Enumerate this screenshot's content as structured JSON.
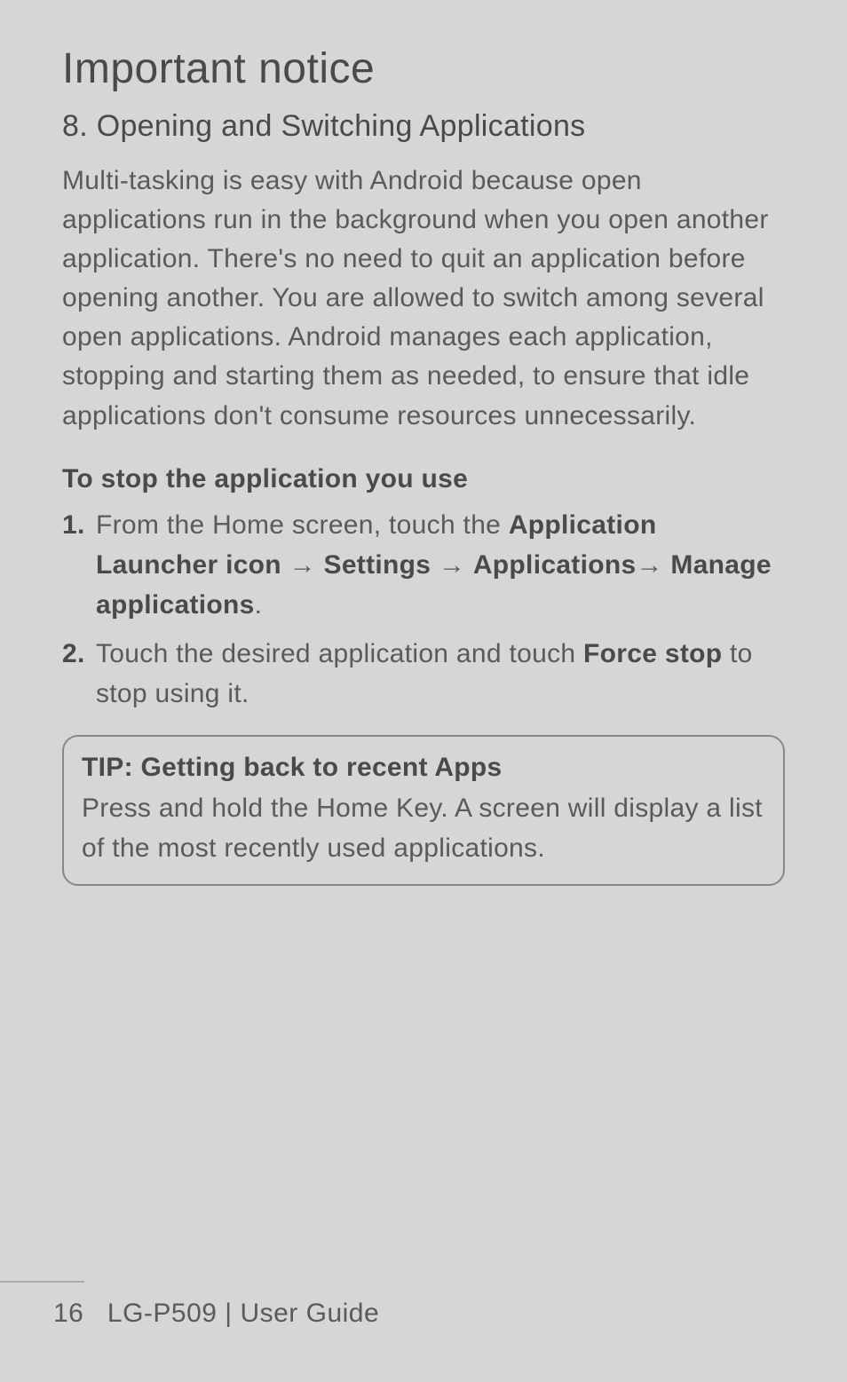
{
  "title": "Important notice",
  "section": {
    "heading": "8. Opening and Switching Applications",
    "body": "Multi-tasking is easy with Android because open applications run in the background when you open another application. There's no need to quit an application before opening another. You are allowed to switch among several open applications. Android manages each application, stopping and starting them as needed, to ensure that idle applications don't consume resources unnecessarily."
  },
  "subheading": "To stop the application you use",
  "steps": [
    {
      "num": "1.",
      "prefix": "From the Home screen, touch the ",
      "bold1": "Application Launcher icon",
      "arrow1": " → ",
      "bold2": "Settings",
      "arrow2": " → ",
      "bold3": "Applications",
      "arrow3": "→ ",
      "bold4": "Manage applications",
      "suffix": "."
    },
    {
      "num": "2.",
      "prefix": "Touch the desired application and touch ",
      "bold1": "Force stop",
      "suffix": " to stop using it."
    }
  ],
  "tip": {
    "title": "TIP: Getting back to recent Apps",
    "body": "Press and hold the Home Key. A screen will display a list of the most recently used applications."
  },
  "footer": {
    "page": "16",
    "model": "LG-P509",
    "sep": "  |  ",
    "doc": "User Guide"
  }
}
